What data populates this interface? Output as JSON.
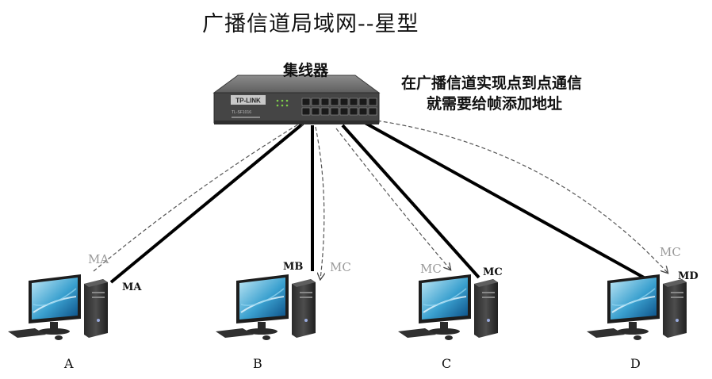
{
  "title": "广播信道局域网--星型",
  "hub": {
    "label": "集线器",
    "brand": "TP-LINK",
    "model": "TL-SF1016"
  },
  "note": {
    "line1": "在广播信道实现点到点通信",
    "line2": "就需要给帧添加地址"
  },
  "hosts": [
    {
      "name": "A",
      "address": "MA"
    },
    {
      "name": "B",
      "address": "MB"
    },
    {
      "name": "C",
      "address": "MC"
    },
    {
      "name": "D",
      "address": "MD"
    }
  ],
  "frame_labels": {
    "sent_from_a": "MA",
    "to_b": "MC",
    "to_c": "MC",
    "to_d": "MC"
  },
  "colors": {
    "cable": "#000000",
    "dashed_arrow": "#555555",
    "grey_label": "#9a9a9a",
    "hub_body": "#4a4a4a"
  }
}
